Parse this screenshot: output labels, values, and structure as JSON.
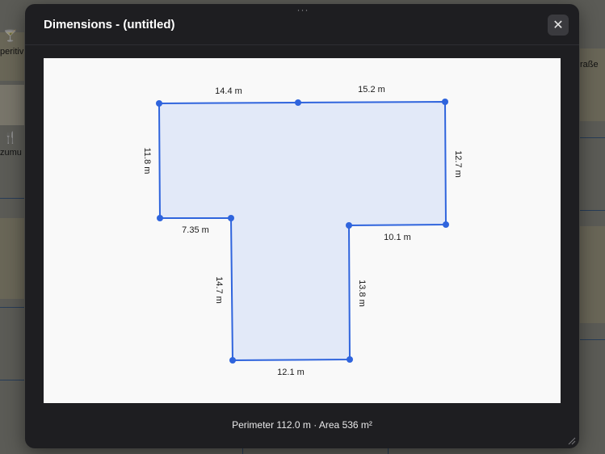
{
  "map": {
    "labels": [
      "peritiv",
      "zumu",
      "raße"
    ]
  },
  "dialog": {
    "title": "Dimensions - (untitled)",
    "close_icon": "close-icon",
    "footer": "Perimeter 112.0 m · Area 536 m²"
  },
  "shape": {
    "fill": "#e2e9f8",
    "stroke": "#2f64dd",
    "edge_labels": [
      "14.4 m",
      "15.2 m",
      "12.7 m",
      "10.1 m",
      "13.8 m",
      "12.1 m",
      "14.7 m",
      "7.35 m",
      "11.8 m"
    ]
  }
}
